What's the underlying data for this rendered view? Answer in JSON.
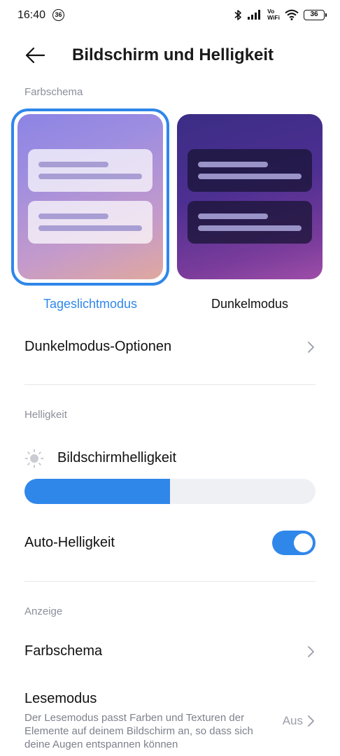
{
  "status_bar": {
    "time": "16:40",
    "badge": "36",
    "volte": "Vo",
    "wifi_label": "WiFi",
    "battery": "36"
  },
  "header": {
    "title": "Bildschirm und Helligkeit",
    "back_icon": "arrow-left-icon"
  },
  "color_scheme_section": {
    "label": "Farbschema",
    "options": [
      {
        "label": "Tageslichtmodus",
        "selected": true
      },
      {
        "label": "Dunkelmodus",
        "selected": false
      }
    ],
    "accent_color": "#2f87ea"
  },
  "dark_mode_options": {
    "label": "Dunkelmodus-Optionen"
  },
  "brightness_section": {
    "label": "Helligkeit",
    "slider_label": "Bildschirmhelligkeit",
    "slider_value_fraction": 0.5,
    "auto_label": "Auto-Helligkeit",
    "auto_enabled": true
  },
  "display_section": {
    "label": "Anzeige",
    "color_scheme_label": "Farbschema",
    "reading_mode": {
      "title": "Lesemodus",
      "description": "Der Lesemodus passt Farben und Texturen der Elemente auf deinem Bildschirm an, so dass sich deine Augen entspannen können",
      "value": "Aus"
    }
  }
}
